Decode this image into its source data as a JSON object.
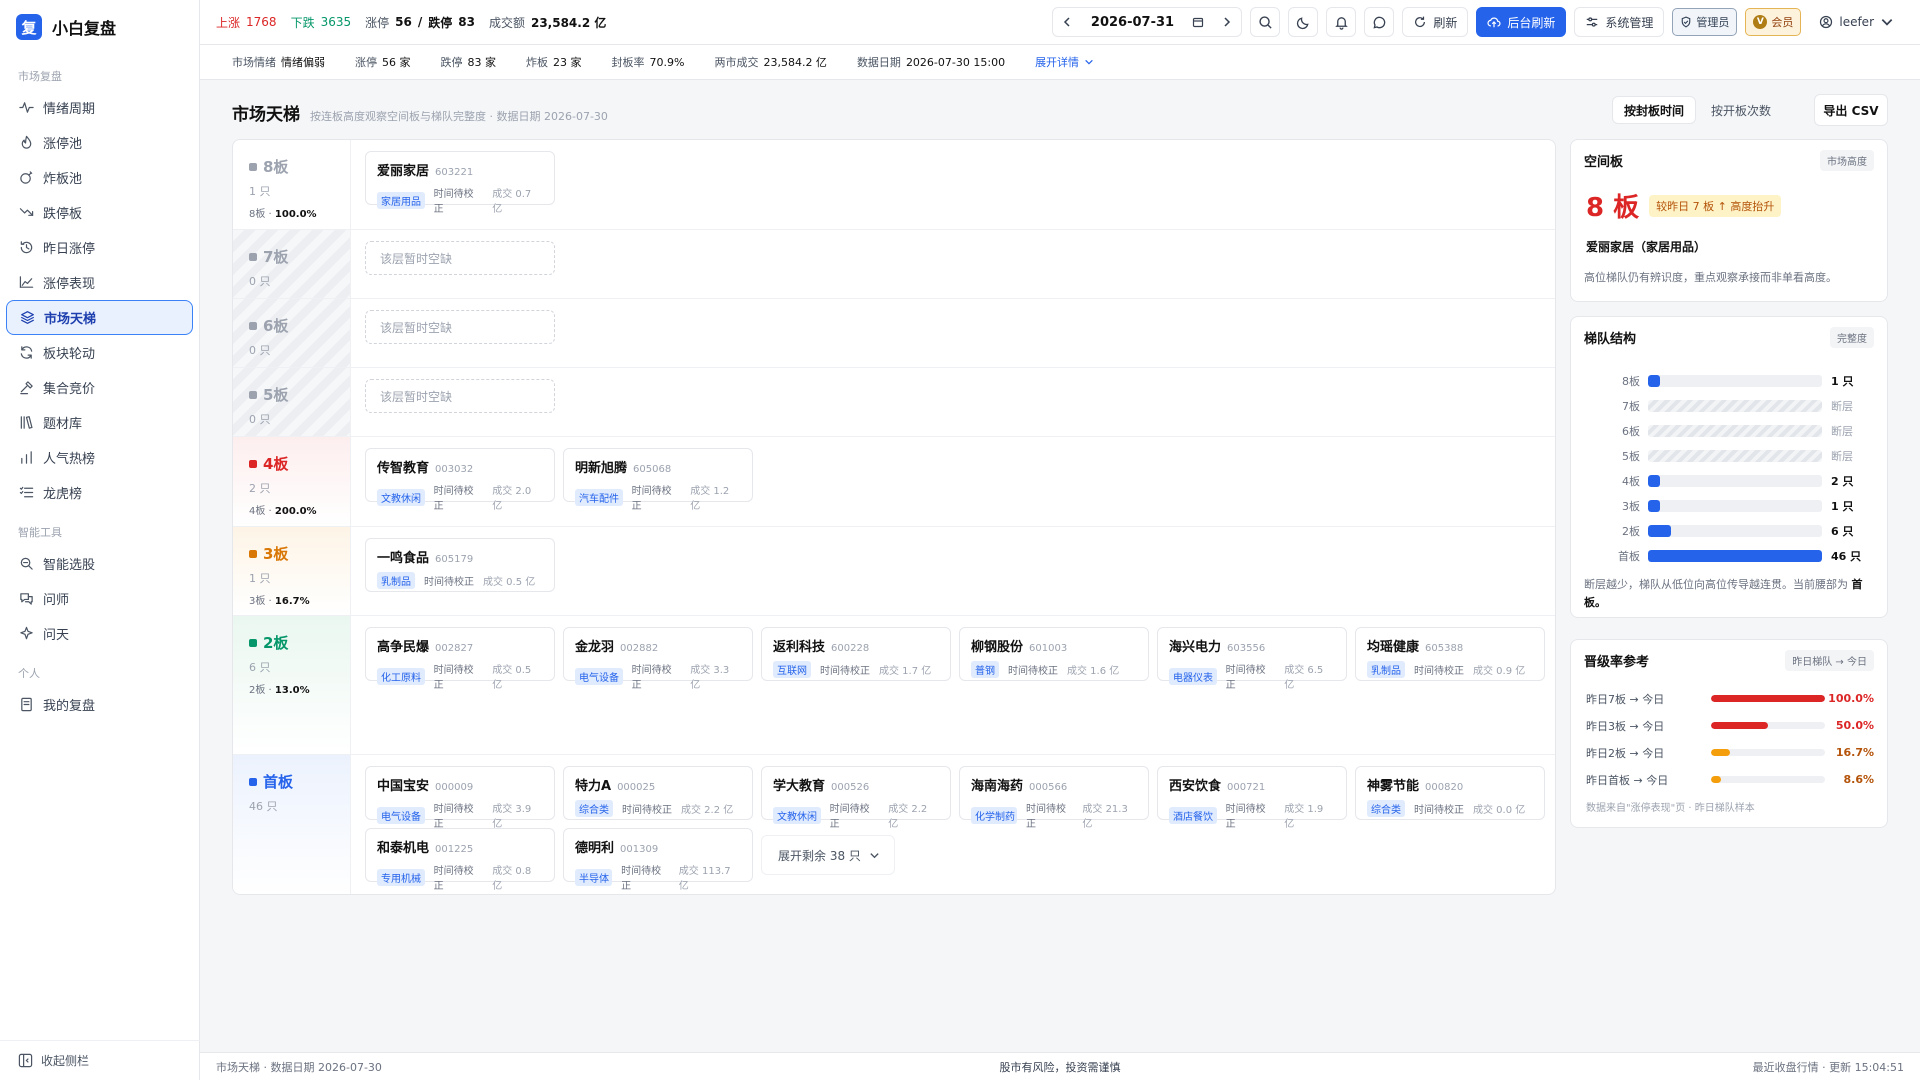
{
  "brand": {
    "logo": "复",
    "name": "小白复盘"
  },
  "nav": {
    "groups": [
      {
        "title": "市场复盘",
        "items": [
          {
            "label": "情绪周期",
            "icon": "pulse-icon"
          },
          {
            "label": "涨停池",
            "icon": "flame-icon"
          },
          {
            "label": "炸板池",
            "icon": "bomb-icon"
          },
          {
            "label": "跌停板",
            "icon": "trend-down-icon"
          },
          {
            "label": "昨日涨停",
            "icon": "history-icon"
          },
          {
            "label": "涨停表现",
            "icon": "area-chart-icon"
          },
          {
            "label": "市场天梯",
            "icon": "layers-icon",
            "active": true
          },
          {
            "label": "板块轮动",
            "icon": "rotate-icon"
          },
          {
            "label": "集合竞价",
            "icon": "gavel-icon"
          },
          {
            "label": "题材库",
            "icon": "library-icon"
          },
          {
            "label": "人气热榜",
            "icon": "bar-chart-icon"
          },
          {
            "label": "龙虎榜",
            "icon": "list-icon"
          }
        ]
      },
      {
        "title": "智能工具",
        "items": [
          {
            "label": "智能选股",
            "icon": "search-scan-icon"
          },
          {
            "label": "问师",
            "icon": "chat-icon"
          },
          {
            "label": "问天",
            "icon": "sparkle-icon"
          }
        ]
      },
      {
        "title": "个人",
        "items": [
          {
            "label": "我的复盘",
            "icon": "notebook-icon"
          }
        ]
      }
    ],
    "collapse": "收起侧栏"
  },
  "topbar": {
    "up_label": "上涨",
    "up": "1768",
    "down_label": "下跌",
    "down": "3635",
    "limit_label": "涨停",
    "limit_up": "56",
    "limit_sep": "/",
    "limit_down_label": "跌停",
    "limit_down": "83",
    "turnover_label": "成交额",
    "turnover": "23,584.2 亿",
    "date": "2026-07-31",
    "refresh": "刷新",
    "bg_refresh": "后台刷新",
    "sys_admin": "系统管理",
    "admin_badge": "管理员",
    "vip_icon": "V",
    "vip_badge": "会员",
    "user": "leefer"
  },
  "subbar": {
    "mood_label": "市场情绪",
    "mood": "情绪偏弱",
    "limit_up_label": "涨停",
    "limit_up": "56 家",
    "limit_down_label": "跌停",
    "limit_down": "83 家",
    "broken_label": "炸板",
    "broken": "23 家",
    "seal_label": "封板率",
    "seal": "70.9%",
    "two_label": "两市成交",
    "two": "23,584.2 亿",
    "date_label": "数据日期",
    "date": "2026-07-30 15:00",
    "expand": "展开详情"
  },
  "main": {
    "title": "市场天梯",
    "subtitle": "按连板高度观察空间板与梯队完整度 · 数据日期 2026-07-30",
    "sort_seal": "按封板时间",
    "sort_open": "按开板次数",
    "export": "导出 CSV",
    "empty_text": "该层暂时空缺",
    "tiers": [
      {
        "level": "8板",
        "count": "1 只",
        "pct_label": "8板 ·",
        "pct": "100.0%",
        "color": "#9ca3af",
        "stocks": [
          {
            "name": "爱丽家居",
            "code": "603221",
            "tag": "家居用品",
            "time": "时间待校正",
            "vol": "成交 0.7 亿"
          }
        ]
      },
      {
        "level": "7板",
        "count": "0 只",
        "empty": true,
        "color": "#9ca3af",
        "stocks": []
      },
      {
        "level": "6板",
        "count": "0 只",
        "empty": true,
        "color": "#9ca3af",
        "stocks": []
      },
      {
        "level": "5板",
        "count": "0 只",
        "empty": true,
        "color": "#9ca3af",
        "stocks": []
      },
      {
        "level": "4板",
        "count": "2 只",
        "pct_label": "4板 ·",
        "pct": "200.0%",
        "color": "#dc2626",
        "stocks": [
          {
            "name": "传智教育",
            "code": "003032",
            "tag": "文教休闲",
            "time": "时间待校正",
            "vol": "成交 2.0 亿"
          },
          {
            "name": "明新旭腾",
            "code": "605068",
            "tag": "汽车配件",
            "time": "时间待校正",
            "vol": "成交 1.2 亿"
          }
        ]
      },
      {
        "level": "3板",
        "count": "1 只",
        "pct_label": "3板 ·",
        "pct": "16.7%",
        "color": "#d97706",
        "stocks": [
          {
            "name": "一鸣食品",
            "code": "605179",
            "tag": "乳制品",
            "time": "时间待校正",
            "vol": "成交 0.5 亿"
          }
        ]
      },
      {
        "level": "2板",
        "count": "6 只",
        "pct_label": "2板 ·",
        "pct": "13.0%",
        "color": "#059669",
        "stocks": [
          {
            "name": "高争民爆",
            "code": "002827",
            "tag": "化工原料",
            "time": "时间待校正",
            "vol": "成交 0.5 亿"
          },
          {
            "name": "金龙羽",
            "code": "002882",
            "tag": "电气设备",
            "time": "时间待校正",
            "vol": "成交 3.3 亿"
          },
          {
            "name": "返利科技",
            "code": "600228",
            "tag": "互联网",
            "time": "时间待校正",
            "vol": "成交 1.7 亿"
          },
          {
            "name": "柳钢股份",
            "code": "601003",
            "tag": "普钢",
            "time": "时间待校正",
            "vol": "成交 1.6 亿"
          },
          {
            "name": "海兴电力",
            "code": "603556",
            "tag": "电器仪表",
            "time": "时间待校正",
            "vol": "成交 6.5 亿"
          },
          {
            "name": "均瑶健康",
            "code": "605388",
            "tag": "乳制品",
            "time": "时间待校正",
            "vol": "成交 0.9 亿"
          }
        ]
      },
      {
        "level": "首板",
        "count": "46 只",
        "color": "#2563eb",
        "stocks": [
          {
            "name": "中国宝安",
            "code": "000009",
            "tag": "电气设备",
            "time": "时间待校正",
            "vol": "成交 3.9 亿"
          },
          {
            "name": "特力A",
            "code": "000025",
            "tag": "综合类",
            "time": "时间待校正",
            "vol": "成交 2.2 亿"
          },
          {
            "name": "学大教育",
            "code": "000526",
            "tag": "文教休闲",
            "time": "时间待校正",
            "vol": "成交 2.2 亿"
          },
          {
            "name": "海南海药",
            "code": "000566",
            "tag": "化学制药",
            "time": "时间待校正",
            "vol": "成交 21.3 亿"
          },
          {
            "name": "西安饮食",
            "code": "000721",
            "tag": "酒店餐饮",
            "time": "时间待校正",
            "vol": "成交 1.9 亿"
          },
          {
            "name": "神雾节能",
            "code": "000820",
            "tag": "综合类",
            "time": "时间待校正",
            "vol": "成交 0.0 亿"
          },
          {
            "name": "和泰机电",
            "code": "001225",
            "tag": "专用机械",
            "time": "时间待校正",
            "vol": "成交 0.8 亿"
          },
          {
            "name": "德明利",
            "code": "001309",
            "tag": "半导体",
            "time": "时间待校正",
            "vol": "成交 113.7 亿"
          }
        ],
        "more": "展开剩余 38 只"
      }
    ]
  },
  "space_panel": {
    "title": "空间板",
    "tag": "市场高度",
    "height": "8 板",
    "chip": "较昨日 7 板 ↑ 高度抬升",
    "stock": "爱丽家居（家居用品）",
    "note": "高位梯队仍有辨识度，重点观察承接而非单看高度。"
  },
  "ladder_panel": {
    "title": "梯队结构",
    "tag": "完整度",
    "rows": [
      {
        "label": "8板",
        "fill": 0.04,
        "value": "1 只"
      },
      {
        "label": "7板",
        "broken": true,
        "value": "断层"
      },
      {
        "label": "6板",
        "broken": true,
        "value": "断层"
      },
      {
        "label": "5板",
        "broken": true,
        "value": "断层"
      },
      {
        "label": "4板",
        "fill": 0.04,
        "value": "2 只"
      },
      {
        "label": "3板",
        "fill": 0.04,
        "value": "1 只"
      },
      {
        "label": "2板",
        "fill": 0.13,
        "value": "6 只"
      },
      {
        "label": "首板",
        "fill": 1.0,
        "value": "46 只"
      }
    ],
    "note": "断层越少，梯队从低位向高位传导越连贯。当前腰部为",
    "note_strong": "首板。"
  },
  "promo_panel": {
    "title": "晋级率参考",
    "tag": "昨日梯队 → 今日",
    "rows": [
      {
        "label": "昨日7板 → 今日",
        "value": "100.0%",
        "fill": 1.0,
        "color": "#dc2626"
      },
      {
        "label": "昨日3板 → 今日",
        "value": "50.0%",
        "fill": 0.5,
        "color": "#dc2626"
      },
      {
        "label": "昨日2板 → 今日",
        "value": "16.7%",
        "fill": 0.167,
        "color": "#f59e0b"
      },
      {
        "label": "昨日首板 → 今日",
        "value": "8.6%",
        "fill": 0.086,
        "color": "#f59e0b"
      }
    ],
    "foot": "数据来自\"涨停表现\"页 · 昨日梯队样本"
  },
  "footer": {
    "left": "市场天梯 · 数据日期 2026-07-30",
    "mid": "股市有风险，投资需谨慎",
    "right": "最近收盘行情 · 更新 15:04:51"
  }
}
